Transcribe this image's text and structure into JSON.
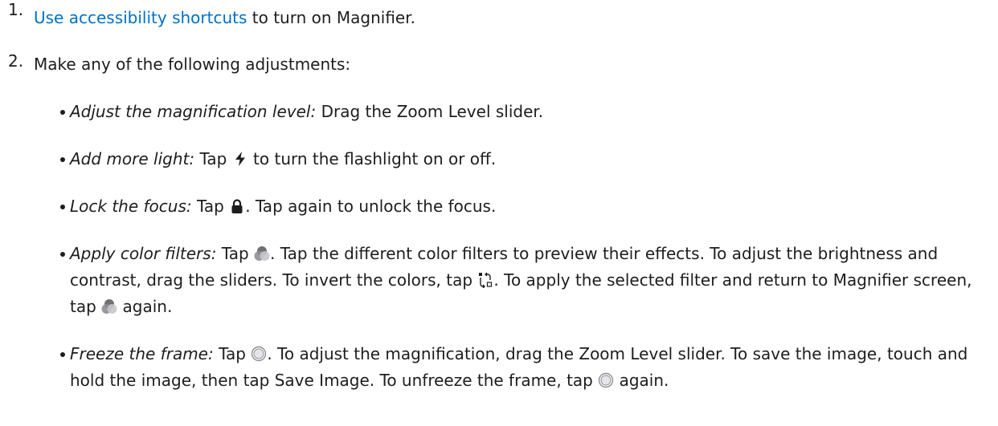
{
  "steps": [
    {
      "number": "1.",
      "link_text": "Use accessibility shortcuts",
      "text": " to turn on Magnifier."
    },
    {
      "number": "2.",
      "text": "Make any of the following adjustments:"
    }
  ],
  "adjustments": [
    {
      "term": "Adjust the magnification level:",
      "text": " Drag the Zoom Level slider."
    },
    {
      "term": "Add more light:",
      "before_icon": " Tap ",
      "icon": "lightning-bolt-icon",
      "after_icon": " to turn the flashlight on or off."
    },
    {
      "term": "Lock the focus:",
      "before_icon": " Tap ",
      "icon": "lock-icon",
      "after_icon": ". Tap again to unlock the focus."
    },
    {
      "term": "Apply color filters:",
      "part1": " Tap ",
      "icon1": "color-filters-icon",
      "part2": ". Tap the different color filters to preview their effects. To adjust the brightness and contrast, drag the sliders. To invert the colors, tap ",
      "icon2": "invert-colors-icon",
      "part3": ". To apply the selected filter and return to Magnifier screen, tap ",
      "icon3": "color-filters-icon",
      "part4": " again."
    },
    {
      "term": "Freeze the frame:",
      "part1": " Tap ",
      "icon1": "shutter-button-icon",
      "part2": ". To adjust the magnification, drag the Zoom Level slider. To save the image, touch and hold the image, then tap Save Image. To unfreeze the frame, tap ",
      "icon2": "shutter-button-icon",
      "part3": " again."
    }
  ],
  "colors": {
    "link": "#0070c9",
    "text": "#1d1d1f"
  }
}
